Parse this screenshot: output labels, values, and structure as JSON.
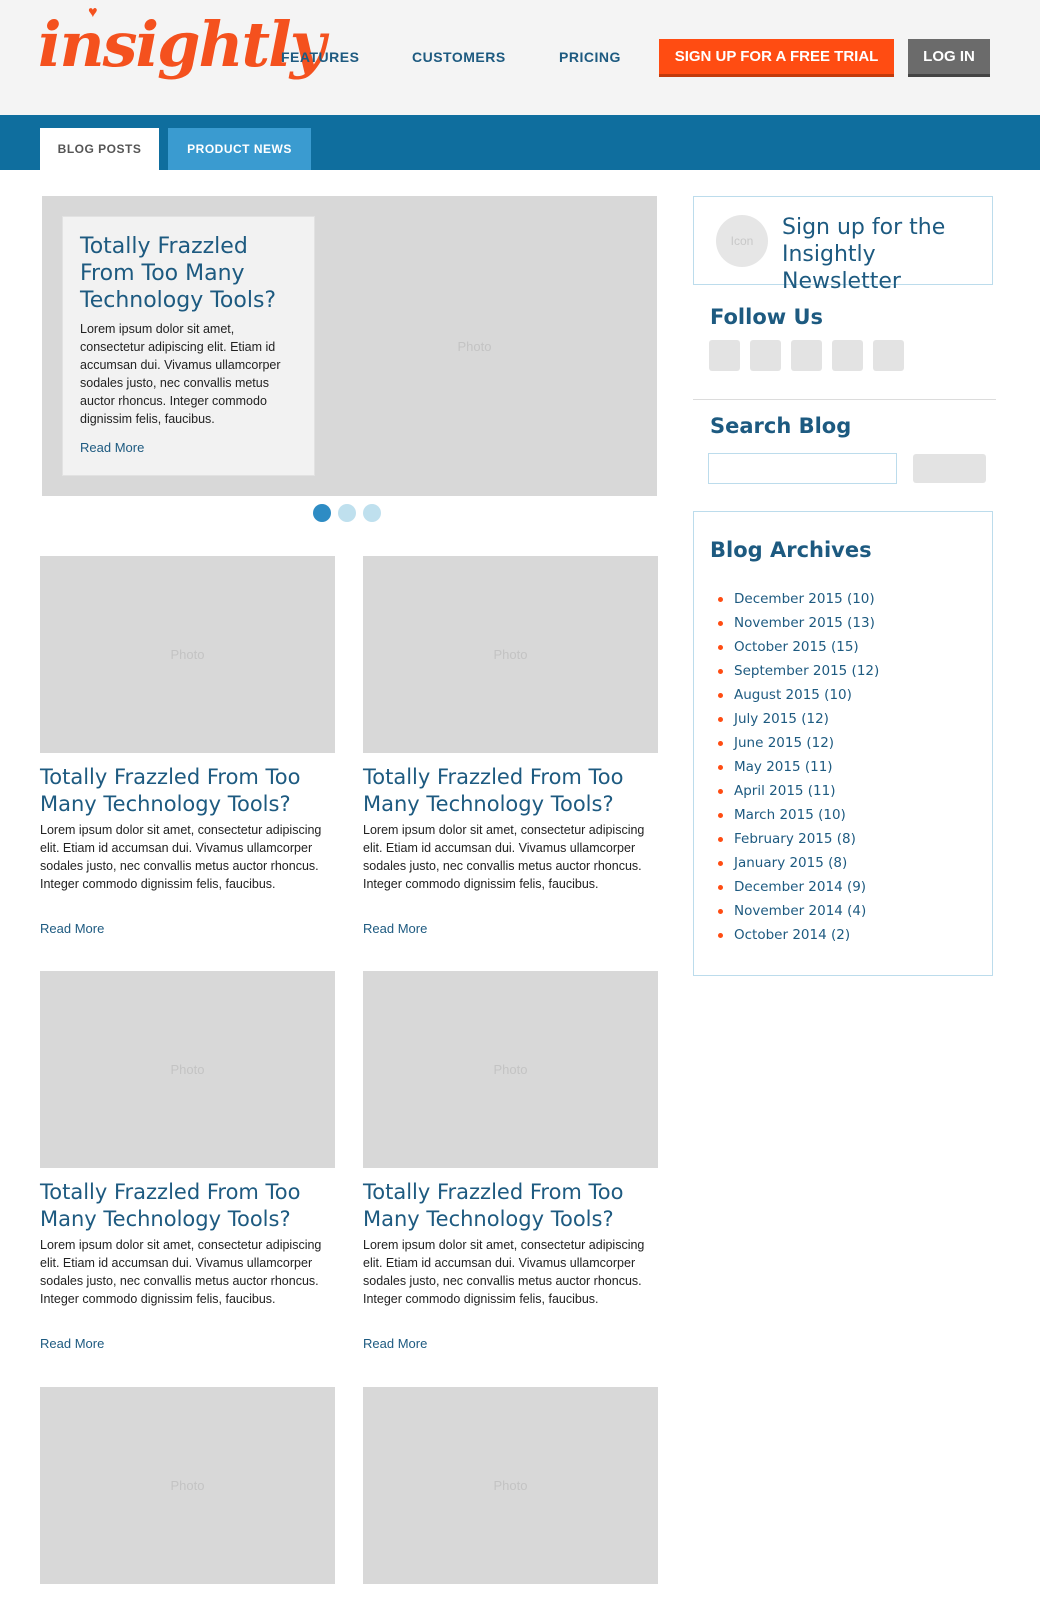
{
  "header": {
    "logo": "insightly",
    "nav": [
      "FEATURES",
      "CUSTOMERS",
      "PRICING"
    ],
    "signup_label": "SIGN UP FOR A FREE TRIAL",
    "login_label": "LOG IN"
  },
  "tabs": [
    "BLOG POSTS",
    "PRODUCT NEWS"
  ],
  "hero": {
    "photo_label": "Photo",
    "title": "Totally Frazzled From Too Many Technology Tools?",
    "text": "Lorem ipsum dolor sit amet, consectetur adipiscing elit. Etiam id accumsan dui. Vivamus ullamcorper sodales justo, nec convallis metus auctor rhoncus. Integer commodo dignissim felis, faucibus.",
    "read_more": "Read More"
  },
  "posts": [
    {
      "photo_label": "Photo",
      "title": "Totally Frazzled From Too Many Technology Tools?",
      "text": "Lorem ipsum dolor sit amet, consectetur adipiscing elit. Etiam id accumsan dui. Vivamus ullamcorper sodales justo, nec convallis metus auctor rhoncus. Integer commodo dignissim felis, faucibus.",
      "read_more": "Read More"
    },
    {
      "photo_label": "Photo",
      "title": "Totally Frazzled From Too Many Technology Tools?",
      "text": "Lorem ipsum dolor sit amet, consectetur adipiscing elit. Etiam id accumsan dui. Vivamus ullamcorper sodales justo, nec convallis metus auctor rhoncus. Integer commodo dignissim felis, faucibus.",
      "read_more": "Read More"
    },
    {
      "photo_label": "Photo",
      "title": "Totally Frazzled From Too Many Technology Tools?",
      "text": "Lorem ipsum dolor sit amet, consectetur adipiscing elit. Etiam id accumsan dui. Vivamus ullamcorper sodales justo, nec convallis metus auctor rhoncus. Integer commodo dignissim felis, faucibus.",
      "read_more": "Read More"
    },
    {
      "photo_label": "Photo",
      "title": "Totally Frazzled From Too Many Technology Tools?",
      "text": "Lorem ipsum dolor sit amet, consectetur adipiscing elit. Etiam id accumsan dui. Vivamus ullamcorper sodales justo, nec convallis metus auctor rhoncus. Integer commodo dignissim felis, faucibus.",
      "read_more": "Read More"
    },
    {
      "photo_label": "Photo"
    },
    {
      "photo_label": "Photo"
    }
  ],
  "sidebar": {
    "newsletter": {
      "icon_label": "Icon",
      "text_line1": "Sign up for the",
      "text_line2": "Insightly Newsletter"
    },
    "follow_title": "Follow Us",
    "search_title": "Search Blog",
    "archives_title": "Blog Archives",
    "archives": [
      "December 2015 (10)",
      "November 2015 (13)",
      "October 2015 (15)",
      "September 2015 (12)",
      "August 2015 (10)",
      "July 2015 (12)",
      "June 2015 (12)",
      "May 2015 (11)",
      "April 2015 (11)",
      "March 2015 (10)",
      "February 2015 (8)",
      "January 2015 (8)",
      "December 2014 (9)",
      "November 2014 (4)",
      "October 2014 (2)"
    ]
  },
  "colors": {
    "brand_orange": "#ff4c12",
    "brand_blue": "#0f6e9e",
    "link_blue": "#1d5a80"
  }
}
